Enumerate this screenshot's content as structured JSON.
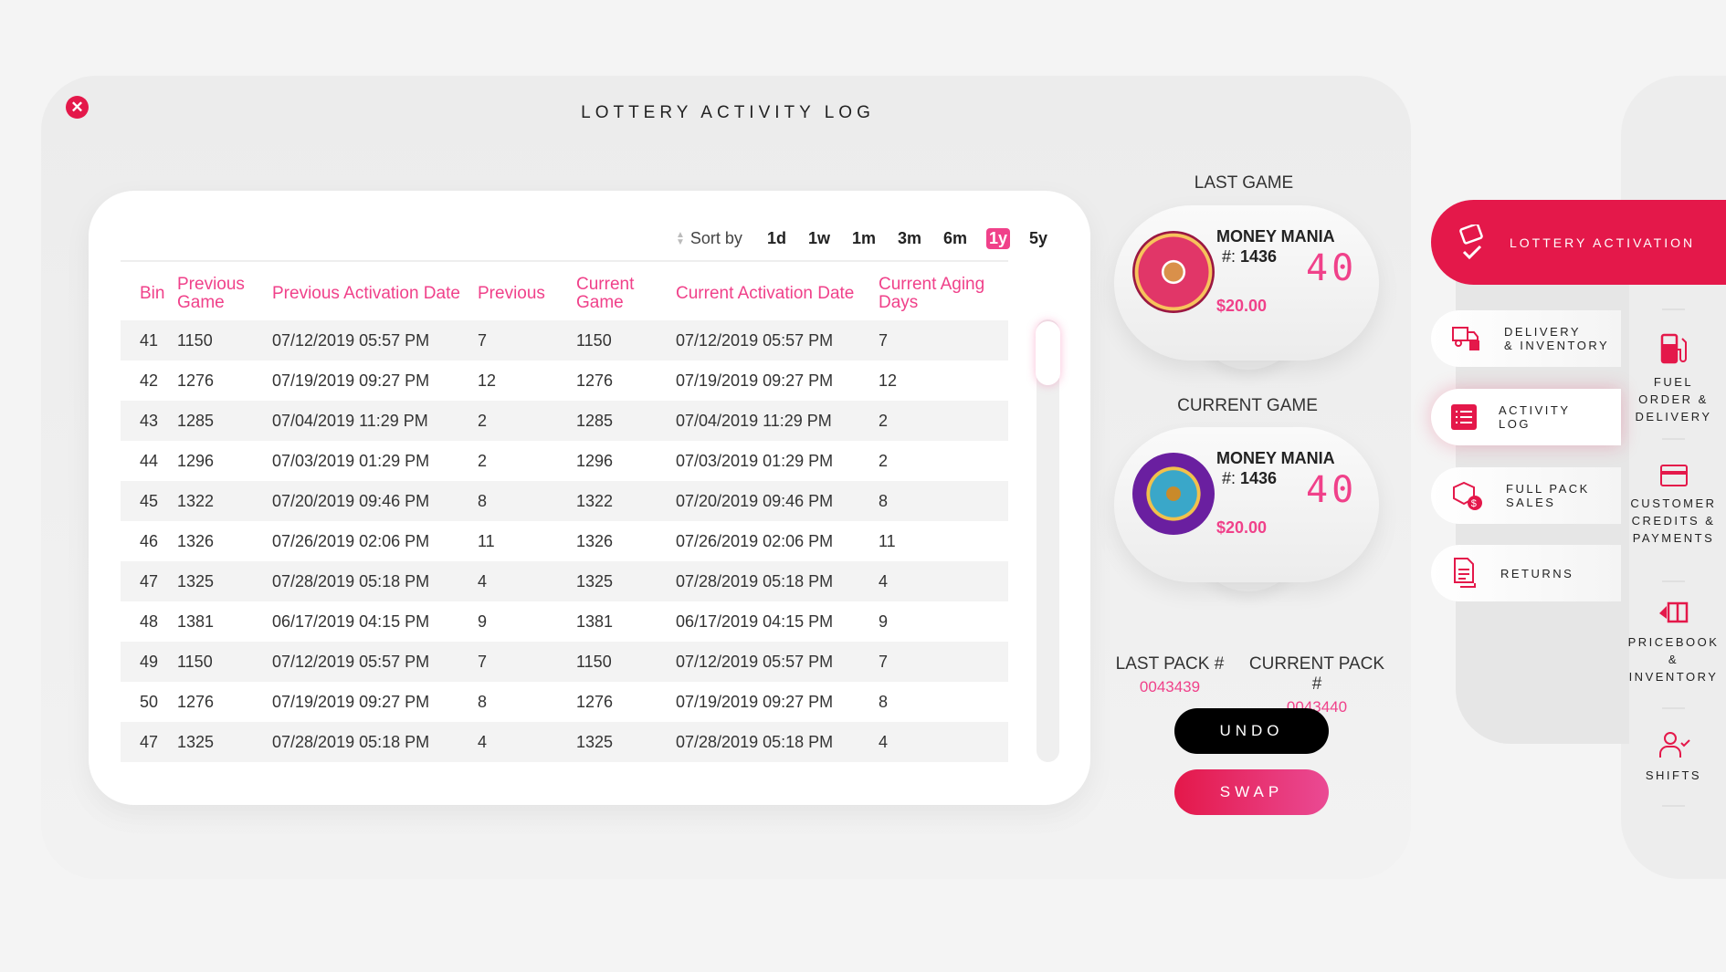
{
  "title": "LOTTERY ACTIVITY LOG",
  "sort": {
    "label": "Sort by",
    "options": [
      "1d",
      "1w",
      "1m",
      "3m",
      "6m",
      "1y",
      "5y"
    ],
    "active": "1y"
  },
  "table": {
    "headers": [
      "Bin",
      "Previous Game",
      "Previous Activation Date",
      "Previous",
      "Current Game",
      "Current Activation Date",
      "Current Aging Days"
    ],
    "rows": [
      [
        "41",
        "1150",
        "07/12/2019 05:57 PM",
        "7",
        "1150",
        "07/12/2019 05:57 PM",
        "7"
      ],
      [
        "42",
        "1276",
        "07/19/2019 09:27 PM",
        "12",
        "1276",
        "07/19/2019 09:27 PM",
        "12"
      ],
      [
        "43",
        "1285",
        "07/04/2019 11:29 PM",
        "2",
        "1285",
        "07/04/2019 11:29 PM",
        "2"
      ],
      [
        "44",
        "1296",
        "07/03/2019 01:29 PM",
        "2",
        "1296",
        "07/03/2019 01:29 PM",
        "2"
      ],
      [
        "45",
        "1322",
        "07/20/2019 09:46 PM",
        "8",
        "1322",
        "07/20/2019 09:46 PM",
        "8"
      ],
      [
        "46",
        "1326",
        "07/26/2019 02:06 PM",
        "11",
        "1326",
        "07/26/2019 02:06 PM",
        "11"
      ],
      [
        "47",
        "1325",
        "07/28/2019 05:18 PM",
        "4",
        "1325",
        "07/28/2019 05:18 PM",
        "4"
      ],
      [
        "48",
        "1381",
        "06/17/2019 04:15 PM",
        "9",
        "1381",
        "06/17/2019 04:15 PM",
        "9"
      ],
      [
        "49",
        "1150",
        "07/12/2019 05:57 PM",
        "7",
        "1150",
        "07/12/2019 05:57 PM",
        "7"
      ],
      [
        "50",
        "1276",
        "07/19/2019 09:27 PM",
        "8",
        "1276",
        "07/19/2019 09:27 PM",
        "8"
      ],
      [
        "47",
        "1325",
        "07/28/2019 05:18 PM",
        "4",
        "1325",
        "07/28/2019 05:18 PM",
        "4"
      ]
    ]
  },
  "last_game": {
    "label": "LAST GAME",
    "name": "MONEY MANIA",
    "num_prefix": "#: ",
    "num": "1436",
    "count": "40",
    "price": "$20.00"
  },
  "current_game": {
    "label": "CURRENT GAME",
    "name": "MONEY MANIA",
    "num_prefix": "#: ",
    "num": "1436",
    "count": "40",
    "price": "$20.00"
  },
  "packs": {
    "last_label": "LAST PACK #",
    "last_value": "0043439",
    "current_label": "CURRENT PACK #",
    "current_value": "0043440"
  },
  "buttons": {
    "undo": "UNDO",
    "swap": "SWAP"
  },
  "menu": {
    "lottery_activation": "LOTTERY ACTIVATION",
    "delivery": [
      "DELIVERY",
      "& INVENTORY"
    ],
    "activity_log": [
      "ACTIVITY",
      "LOG"
    ],
    "full_pack": [
      "FULL PACK",
      "SALES"
    ],
    "returns": "RETURNS"
  },
  "right_nav": {
    "fuel": [
      "FUEL",
      "ORDER &",
      "DELIVERY"
    ],
    "credits": [
      "CUSTOMER",
      "CREDITS &",
      "PAYMENTS"
    ],
    "pricebook": [
      "PRICEBOOK",
      "&",
      "INVENTORY"
    ],
    "shifts": "SHIFTS"
  },
  "colors": {
    "accent": "#e4184a",
    "pink": "#f0418a"
  }
}
